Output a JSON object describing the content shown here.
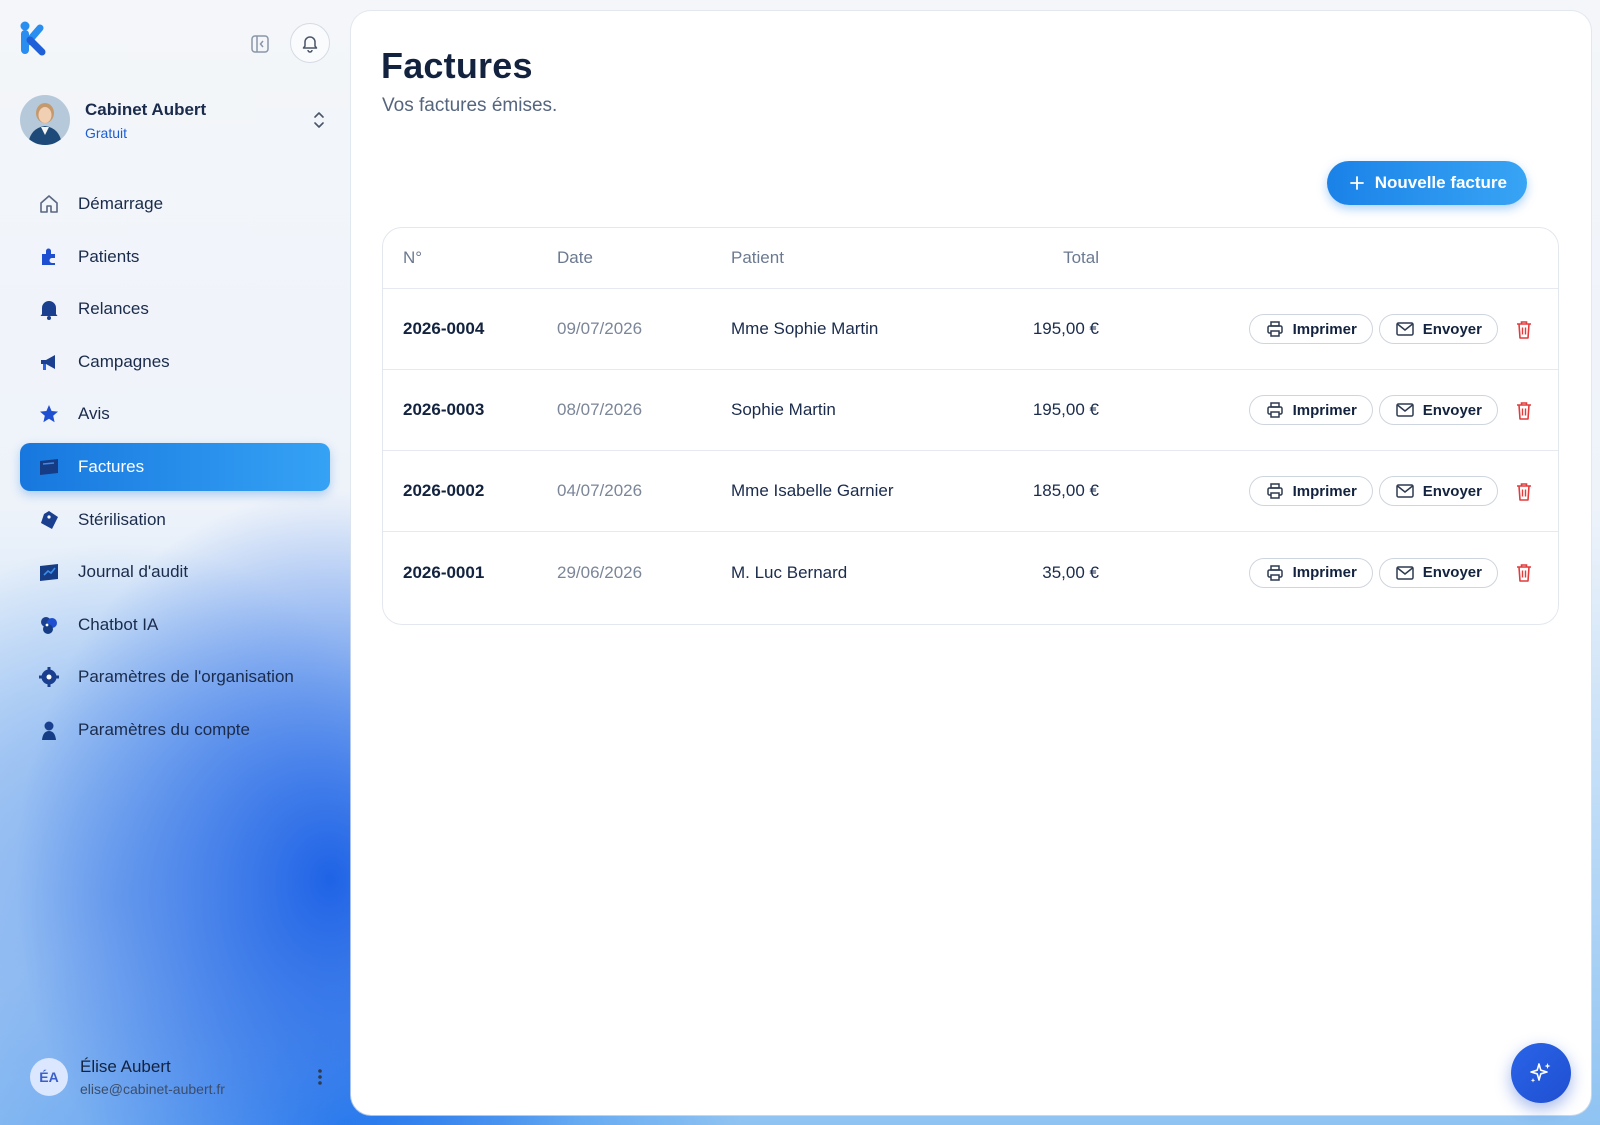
{
  "sidebar": {
    "org": {
      "name": "Cabinet Aubert",
      "plan": "Gratuit"
    },
    "items": [
      {
        "label": "Démarrage",
        "icon": "home-icon",
        "active": false
      },
      {
        "label": "Patients",
        "icon": "puzzle-icon",
        "active": false
      },
      {
        "label": "Relances",
        "icon": "bell-icon",
        "active": false
      },
      {
        "label": "Campagnes",
        "icon": "megaphone-icon",
        "active": false
      },
      {
        "label": "Avis",
        "icon": "star-icon",
        "active": false
      },
      {
        "label": "Factures",
        "icon": "invoice-icon",
        "active": true
      },
      {
        "label": "Stérilisation",
        "icon": "tag-icon",
        "active": false
      },
      {
        "label": "Journal d'audit",
        "icon": "journal-icon",
        "active": false
      },
      {
        "label": "Chatbot IA",
        "icon": "robot-icon",
        "active": false
      },
      {
        "label": "Paramètres de l'organisation",
        "icon": "gear-icon",
        "active": false
      },
      {
        "label": "Paramètres du compte",
        "icon": "person-icon",
        "active": false
      }
    ],
    "user": {
      "initials": "ÉA",
      "name": "Élise Aubert",
      "email": "elise@cabinet-aubert.fr"
    }
  },
  "main": {
    "title": "Factures",
    "subtitle": "Vos factures émises.",
    "new_button": "Nouvelle facture",
    "columns": {
      "num": "N°",
      "date": "Date",
      "patient": "Patient",
      "total": "Total"
    },
    "print_label": "Imprimer",
    "send_label": "Envoyer",
    "rows": [
      {
        "num": "2026-0004",
        "date": "09/07/2026",
        "patient": "Mme Sophie Martin",
        "total": "195,00 €"
      },
      {
        "num": "2026-0003",
        "date": "08/07/2026",
        "patient": "Sophie Martin",
        "total": "195,00 €"
      },
      {
        "num": "2026-0002",
        "date": "04/07/2026",
        "patient": "Mme Isabelle Garnier",
        "total": "185,00 €"
      },
      {
        "num": "2026-0001",
        "date": "29/06/2026",
        "patient": "M. Luc Bernard",
        "total": "35,00 €"
      }
    ]
  },
  "colors": {
    "accent": "#1a82e8",
    "brand": "#1f4fd1",
    "danger": "#e23b3b",
    "text": "#13233f"
  }
}
